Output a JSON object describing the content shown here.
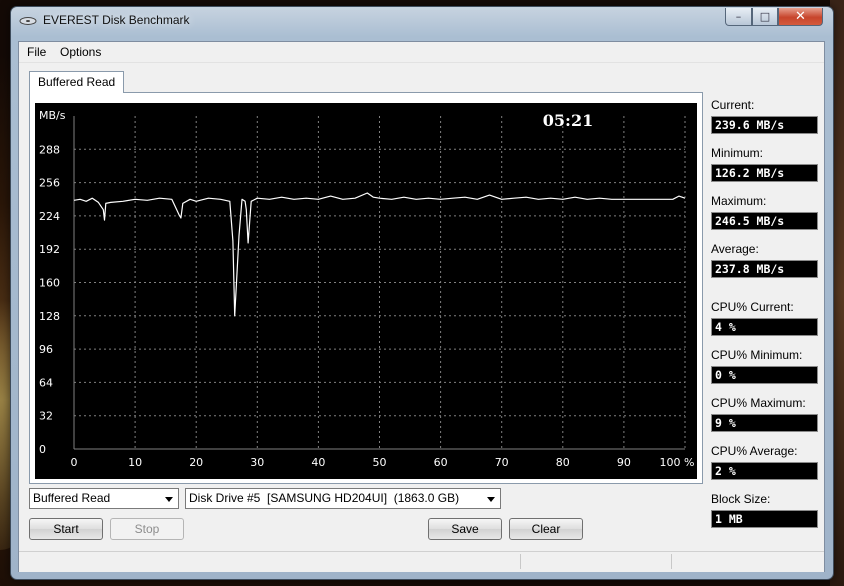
{
  "window": {
    "title": "EVEREST Disk Benchmark",
    "controls": {
      "minimize": "–",
      "maximize": "□",
      "close": "✕"
    }
  },
  "menu": {
    "items": [
      "File",
      "Options"
    ]
  },
  "tabs": [
    {
      "label": "Buffered Read",
      "active": true
    }
  ],
  "graph": {
    "unit_label": "MB/s",
    "timer": "05:21",
    "x_suffix": "%",
    "y_ticks": [
      "288",
      "256",
      "224",
      "192",
      "160",
      "128",
      "96",
      "64",
      "32",
      "0"
    ],
    "x_ticks": [
      "0",
      "10",
      "20",
      "30",
      "40",
      "50",
      "60",
      "70",
      "80",
      "90",
      "100 %"
    ]
  },
  "chart_data": {
    "type": "line",
    "x": [
      0,
      1,
      2,
      3,
      4,
      4.8,
      5,
      5.2,
      6,
      8,
      10,
      12,
      14,
      16,
      17.2,
      17.5,
      17.8,
      19,
      20,
      22,
      24,
      25.5,
      26,
      26.3,
      26.6,
      27,
      27.5,
      28,
      28.2,
      28.5,
      29,
      30,
      32,
      34,
      36,
      38,
      40,
      42,
      44,
      46,
      48,
      49,
      50,
      52,
      54,
      56,
      58,
      60,
      62,
      64,
      66,
      68,
      70,
      72,
      74,
      76,
      78,
      80,
      82,
      84,
      86,
      88,
      90,
      92,
      94,
      96,
      98,
      99,
      100
    ],
    "y": [
      239,
      240,
      238,
      241,
      237,
      230,
      220,
      236,
      237,
      238,
      240,
      239,
      241,
      240,
      225,
      222,
      236,
      240,
      238,
      241,
      240,
      238,
      200,
      128,
      160,
      205,
      240,
      238,
      230,
      198,
      238,
      241,
      240,
      242,
      240,
      241,
      240,
      243,
      240,
      241,
      246,
      242,
      241,
      240,
      242,
      240,
      241,
      240,
      241,
      242,
      240,
      244,
      240,
      241,
      242,
      240,
      241,
      240,
      242,
      240,
      241,
      240,
      240,
      240,
      240,
      240,
      240,
      243,
      241
    ],
    "xlabel": "",
    "ylabel": "MB/s",
    "xlim": [
      0,
      100
    ],
    "ylim": [
      0,
      320
    ],
    "grid": true,
    "line_color": "#ffffff",
    "background": "#000000"
  },
  "stats": [
    {
      "label": "Current:",
      "value": "239.6 MB/s"
    },
    {
      "label": "Minimum:",
      "value": "126.2 MB/s"
    },
    {
      "label": "Maximum:",
      "value": "246.5 MB/s"
    },
    {
      "label": "Average:",
      "value": "237.8 MB/s"
    },
    {
      "label": "CPU% Current:",
      "value": "4 %"
    },
    {
      "label": "CPU% Minimum:",
      "value": "0 %"
    },
    {
      "label": "CPU% Maximum:",
      "value": "9 %"
    },
    {
      "label": "CPU% Average:",
      "value": "2 %"
    },
    {
      "label": "Block Size:",
      "value": "1 MB"
    }
  ],
  "controls": {
    "mode_select": "Buffered Read",
    "drive_select": "Disk Drive #5  [SAMSUNG HD204UI]  (1863.0 GB)",
    "start": "Start",
    "stop": "Stop",
    "save": "Save",
    "clear": "Clear"
  },
  "colors": {
    "accent_close": "#c7452c",
    "graph_bg": "#000000",
    "graph_line": "#ffffff",
    "grid": "#808080"
  }
}
